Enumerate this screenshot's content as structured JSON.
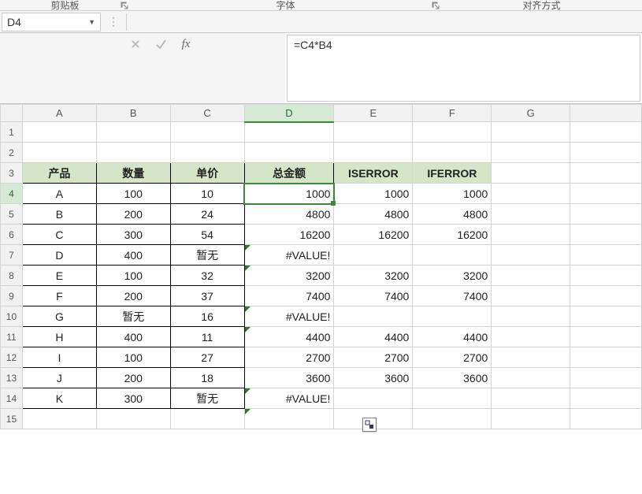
{
  "ribbon": {
    "sec1": "剪贴板",
    "sec2": "字体",
    "sec3": "对齐方式"
  },
  "namebox": {
    "value": "D4"
  },
  "formula": {
    "value": "=C4*B4"
  },
  "columns": [
    "A",
    "B",
    "C",
    "D",
    "E",
    "F",
    "G"
  ],
  "row_headers": [
    "1",
    "2",
    "3",
    "4",
    "5",
    "6",
    "7",
    "8",
    "9",
    "10",
    "11",
    "12",
    "13",
    "14",
    "15"
  ],
  "active": {
    "col": "D",
    "row": 4
  },
  "headers": {
    "a3": "产品",
    "b3": "数量",
    "c3": "单价",
    "d3": "总金额",
    "e3": "ISERROR",
    "f3": "IFERROR"
  },
  "rows": [
    {
      "a": "A",
      "b": "100",
      "c": "10",
      "d": "1000",
      "e": "1000",
      "f": "1000",
      "err": false
    },
    {
      "a": "B",
      "b": "200",
      "c": "24",
      "d": "4800",
      "e": "4800",
      "f": "4800",
      "err": false
    },
    {
      "a": "C",
      "b": "300",
      "c": "54",
      "d": "16200",
      "e": "16200",
      "f": "16200",
      "err": false
    },
    {
      "a": "D",
      "b": "400",
      "c": "暂无",
      "d": "#VALUE!",
      "e": "",
      "f": "",
      "err": true
    },
    {
      "a": "E",
      "b": "100",
      "c": "32",
      "d": "3200",
      "e": "3200",
      "f": "3200",
      "err": false
    },
    {
      "a": "F",
      "b": "200",
      "c": "37",
      "d": "7400",
      "e": "7400",
      "f": "7400",
      "err": false
    },
    {
      "a": "G",
      "b": "暂无",
      "c": "16",
      "d": "#VALUE!",
      "e": "",
      "f": "",
      "err": true
    },
    {
      "a": "H",
      "b": "400",
      "c": "11",
      "d": "4400",
      "e": "4400",
      "f": "4400",
      "err": false
    },
    {
      "a": "I",
      "b": "100",
      "c": "27",
      "d": "2700",
      "e": "2700",
      "f": "2700",
      "err": false
    },
    {
      "a": "J",
      "b": "200",
      "c": "18",
      "d": "3600",
      "e": "3600",
      "f": "3600",
      "err": false
    },
    {
      "a": "K",
      "b": "300",
      "c": "暂无",
      "d": "#VALUE!",
      "e": "",
      "f": "",
      "err": true
    }
  ],
  "chart_data": {
    "type": "table",
    "title": "",
    "columns": [
      "产品",
      "数量",
      "单价",
      "总金额",
      "ISERROR",
      "IFERROR"
    ],
    "rows": [
      [
        "A",
        100,
        10,
        1000,
        1000,
        1000
      ],
      [
        "B",
        200,
        24,
        4800,
        4800,
        4800
      ],
      [
        "C",
        300,
        54,
        16200,
        16200,
        16200
      ],
      [
        "D",
        400,
        "暂无",
        "#VALUE!",
        "",
        ""
      ],
      [
        "E",
        100,
        32,
        3200,
        3200,
        3200
      ],
      [
        "F",
        200,
        37,
        7400,
        7400,
        7400
      ],
      [
        "G",
        "暂无",
        16,
        "#VALUE!",
        "",
        ""
      ],
      [
        "H",
        400,
        11,
        4400,
        4400,
        4400
      ],
      [
        "I",
        100,
        27,
        2700,
        2700,
        2700
      ],
      [
        "J",
        200,
        18,
        3600,
        3600,
        3600
      ],
      [
        "K",
        300,
        "暂无",
        "#VALUE!",
        "",
        ""
      ]
    ]
  }
}
